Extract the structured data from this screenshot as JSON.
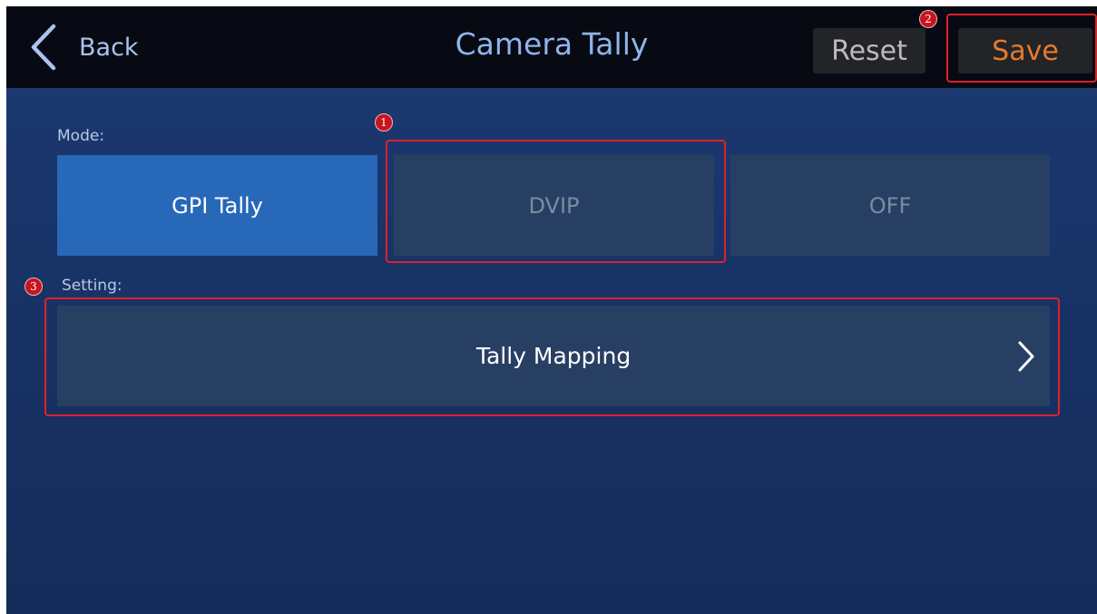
{
  "header": {
    "back_label": "Back",
    "title": "Camera Tally",
    "reset_label": "Reset",
    "save_label": "Save"
  },
  "mode": {
    "label": "Mode:",
    "options": [
      {
        "label": "GPI Tally",
        "selected": true
      },
      {
        "label": "DVIP",
        "selected": false
      },
      {
        "label": "OFF",
        "selected": false
      }
    ]
  },
  "setting": {
    "label": "Setting:",
    "items": [
      {
        "label": "Tally Mapping"
      }
    ]
  },
  "callouts": [
    {
      "number": "1",
      "target": "DVIP"
    },
    {
      "number": "2",
      "target": "Save"
    },
    {
      "number": "3",
      "target": "Tally Mapping"
    }
  ],
  "icons": {
    "back": "chevron-left-icon",
    "tally_mapping": "chevron-right-icon"
  },
  "colors": {
    "header_bg": "#070a12",
    "screen_bg": "#183366",
    "title_text": "#8fb4ea",
    "selected_mode": "#2768b9",
    "unselected_mode": "#283f64",
    "save_text": "#e77a2c",
    "callout_red": "#e0202a"
  }
}
